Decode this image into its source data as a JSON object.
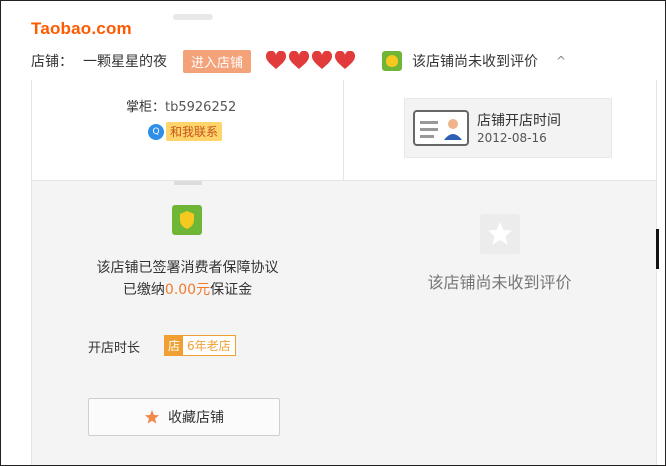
{
  "logo": "Taobao.com",
  "topbar": {
    "shop_label": "店铺：",
    "shop_name": "一颗星星的夜",
    "enter_shop": "进入店铺",
    "no_review": "该店铺尚未收到评价",
    "caret": "^"
  },
  "owner": {
    "label": "掌柜：",
    "id": "tb5926252",
    "contact": "和我联系",
    "qq_glyph": "Q"
  },
  "since": {
    "title": "店铺开店时间",
    "date": "2012-08-16"
  },
  "guarantee": {
    "line1": "该店铺已签署消费者保障协议",
    "line2_prefix": "已缴纳",
    "amount": "0.00元",
    "line2_suffix": "保证金"
  },
  "right_panel": {
    "no_review": "该店铺尚未收到评价"
  },
  "duration": {
    "label": "开店时长",
    "badge_char": "店",
    "years": "6年老店"
  },
  "favorite": {
    "label": "收藏店铺"
  },
  "colors": {
    "brand": "#ff5a00",
    "heart": "#e23b3b",
    "amount": "#f07b2c",
    "badge": "#f0a033"
  }
}
